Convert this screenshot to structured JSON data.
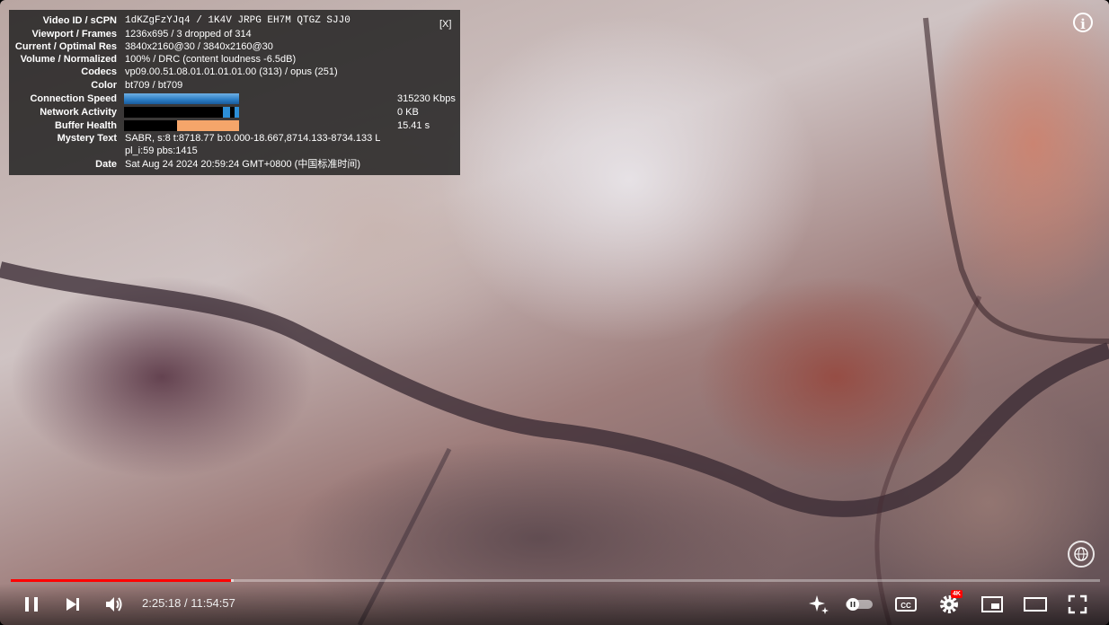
{
  "stats_panel": {
    "close_label": "[X]",
    "rows": [
      {
        "label": "Video ID / sCPN",
        "value": "1dKZgFzYJq4 / 1K4V JRPG EH7M QTGZ SJJ0"
      },
      {
        "label": "Viewport / Frames",
        "value": "1236x695 / 3 dropped of 314"
      },
      {
        "label": "Current / Optimal Res",
        "value": "3840x2160@30 / 3840x2160@30"
      },
      {
        "label": "Volume / Normalized",
        "value": "100% / DRC (content loudness -6.5dB)"
      },
      {
        "label": "Codecs",
        "value": "vp09.00.51.08.01.01.01.01.00 (313) / opus (251)"
      },
      {
        "label": "Color",
        "value": "bt709 / bt709"
      }
    ],
    "graphs": [
      {
        "label": "Connection Speed",
        "value": "315230 Kbps",
        "color": "#3d8fd1"
      },
      {
        "label": "Network Activity",
        "value": "0 KB",
        "color": "#2d8fd8"
      },
      {
        "label": "Buffer Health",
        "value": "15.41 s",
        "color": "#f5a56a"
      }
    ],
    "mystery_text": {
      "label": "Mystery Text",
      "line1": "SABR, s:8 t:8718.77 b:0.000-18.667,8714.133-8734.133 L",
      "line2": "pl_i:59 pbs:1415"
    },
    "date": {
      "label": "Date",
      "value": "Sat Aug 24 2024 20:59:24 GMT+0800 (中国标准时间)"
    }
  },
  "player": {
    "info_icon": "info-icon",
    "progress": {
      "played_fraction": 0.2024,
      "buffered_fraction": 0.2049
    },
    "time": {
      "current": "2:25:18",
      "separator": " / ",
      "duration": "11:54:57"
    },
    "settings_badge": "4K",
    "icons": {
      "play_pause": "pause-icon",
      "next": "skip-next-icon",
      "volume": "volume-icon",
      "sparkle": "sparkle-icon",
      "autoplay": "autoplay-toggle",
      "captions": "cc-icon",
      "settings": "gear-icon",
      "miniplayer": "miniplayer-icon",
      "theater": "theater-icon",
      "fullscreen": "fullscreen-icon"
    },
    "colors": {
      "progress": "#ff0000",
      "badge": "#ff0000"
    }
  }
}
